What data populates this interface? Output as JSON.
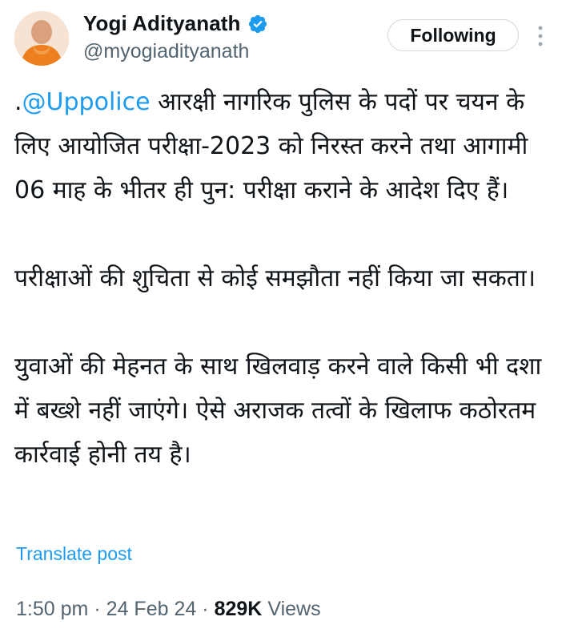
{
  "author": {
    "display_name": "Yogi Adityanath",
    "handle": "@myogiadityanath",
    "verified": true
  },
  "follow_button_label": "Following",
  "tweet": {
    "paragraphs": [
      {
        "prefix": ".",
        "mention": "@Uppolice",
        "text": " आरक्षी नागरिक पुलिस के पदों पर चयन के लिए आयोजित परीक्षा-2023 को निरस्त करने तथा आगामी 06 माह के भीतर ही पुन: परीक्षा कराने के आदेश दिए हैं।"
      },
      {
        "text": "परीक्षाओं की शुचिता से कोई समझौता नहीं किया जा सकता।"
      },
      {
        "text": "युवाओं की मेहनत के साथ खिलवाड़ करने वाले किसी भी दशा में बख्शे नहीं जाएंगे। ऐसे अराजक तत्वों के खिलाफ कठोरतम कार्रवाई होनी तय है।"
      }
    ]
  },
  "translate_label": "Translate post",
  "meta": {
    "time": "1:50 pm",
    "separator": "·",
    "date": "24 Feb 24",
    "views_count": "829K",
    "views_label": "Views"
  },
  "colors": {
    "accent": "#1d9bf0",
    "text": "#0f1419",
    "secondary": "#536471"
  },
  "icons": {
    "verified": "verified-badge-icon",
    "more": "more-vertical-icon"
  }
}
